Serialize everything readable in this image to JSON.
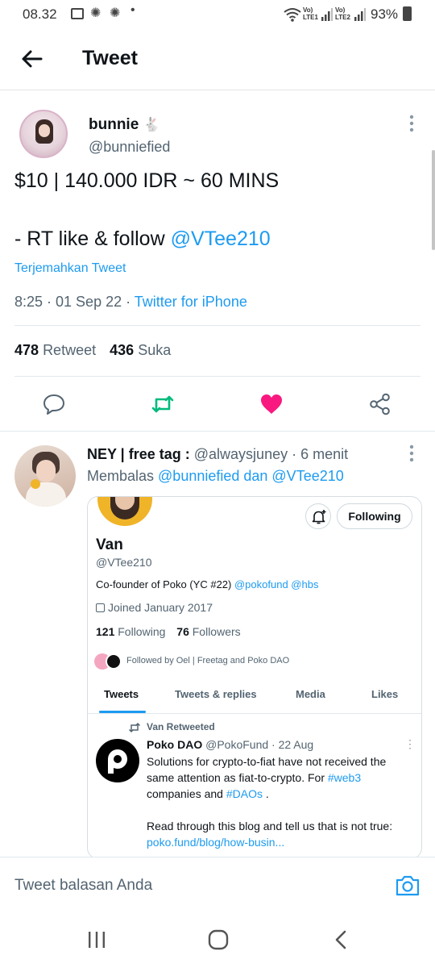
{
  "status": {
    "time": "08.32",
    "battery": "93%",
    "net1": "Vo) LTE1",
    "net2": "Vo) LTE2"
  },
  "header": {
    "title": "Tweet"
  },
  "tweet": {
    "name": "bunnie",
    "name_emoji": "🐇",
    "handle": "@bunniefied",
    "line1": "$10 | 140.000 IDR ~ 60 MINS",
    "line2_prefix": "- RT like & follow ",
    "line2_mention": "@VTee210",
    "translate": "Terjemahkan Tweet",
    "meta_time": "8:25 · 01 Sep 22 · ",
    "meta_source": "Twitter for iPhone",
    "retweets": "478",
    "retweets_label": "Retweet",
    "likes": "436",
    "likes_label": "Suka"
  },
  "reply": {
    "name": "NEY | free tag :",
    "handle_time": "@alwaysjuney · 6 menit",
    "replying_prefix": "Membalas ",
    "replying_mentions": "@bunniefied dan @VTee210",
    "card": {
      "name": "Van",
      "handle": "@VTee210",
      "follow_button": "Following",
      "bio_prefix": "Co-founder of Poko (YC #22) ",
      "bio_links": "@pokofund @hbs",
      "joined": "Joined January 2017",
      "following_count": "121",
      "following_label": "Following",
      "followers_count": "76",
      "followers_label": "Followers",
      "followed_by": "Followed by Oel | Freetag and Poko DAO",
      "tabs": [
        "Tweets",
        "Tweets & replies",
        "Media",
        "Likes"
      ],
      "retweeted_by": "Van Retweeted",
      "inner_name": "Poko DAO",
      "inner_handle_date": "@PokoFund · 22 Aug",
      "inner_line1": "Solutions for crypto-to-fiat have not received the",
      "inner_line2_prefix": "same attention as fiat-to-crypto. For ",
      "inner_line2_tag": "#web3",
      "inner_line3_prefix": "companies and ",
      "inner_line3_tag": "#DAOs",
      "inner_line3_suffix": " .",
      "inner_line4": "Read through this blog and tell us that is not true:",
      "inner_link": "poko.fund/blog/how-busin..."
    }
  },
  "composer": {
    "placeholder": "Tweet balasan Anda"
  },
  "colors": {
    "accent": "#1d9bf0",
    "retweet": "#00ba7c",
    "like": "#f91880"
  }
}
